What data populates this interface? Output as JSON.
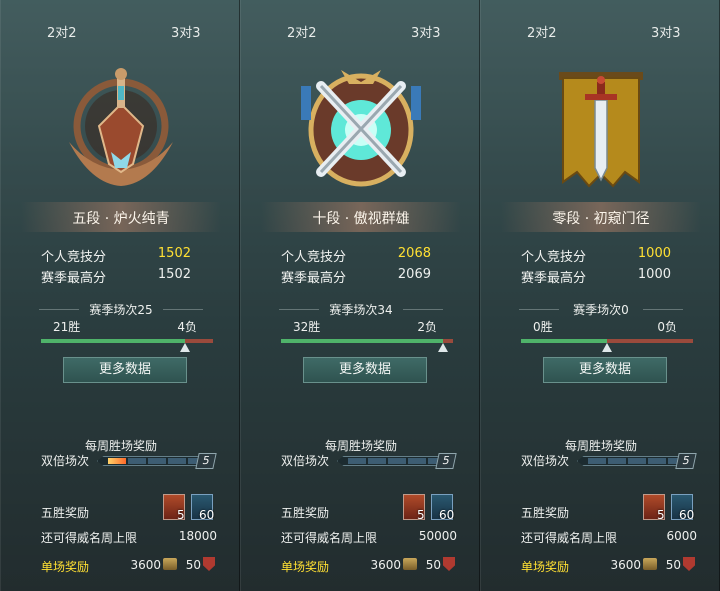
{
  "panels": [
    {
      "tabs": {
        "mode_2v2": "2对2",
        "mode_3v3": "3对3"
      },
      "emblem": "bronze-helmet-emblem",
      "rank_name": "五段 · 炉火纯青",
      "stats": {
        "personal_label": "个人竞技分",
        "personal_value": "1502",
        "season_high_label": "赛季最高分",
        "season_high_value": "1502"
      },
      "season_matches": "赛季场次25",
      "wins": "21胜",
      "losses": "4负",
      "win_fraction": 0.84,
      "more_data": "更多数据",
      "weekly": {
        "title": "每周胜场奖励",
        "double_label": "双倍场次",
        "double_count": "5",
        "double_lit": 1,
        "five_win_label": "五胜奖励",
        "reward_1_count": "5",
        "reward_2_count": "60",
        "cap_label": "还可得威名周上限",
        "cap_value": "18000",
        "single_label": "单场奖励",
        "single_coin": "3600",
        "single_badge": "50"
      }
    },
    {
      "tabs": {
        "mode_2v2": "2对2",
        "mode_3v3": "3对3"
      },
      "emblem": "crossed-swords-emblem",
      "rank_name": "十段 · 傲视群雄",
      "stats": {
        "personal_label": "个人竞技分",
        "personal_value": "2068",
        "season_high_label": "赛季最高分",
        "season_high_value": "2069"
      },
      "season_matches": "赛季场次34",
      "wins": "32胜",
      "losses": "2负",
      "win_fraction": 0.94,
      "more_data": "更多数据",
      "weekly": {
        "title": "每周胜场奖励",
        "double_label": "双倍场次",
        "double_count": "5",
        "double_lit": 0,
        "five_win_label": "五胜奖励",
        "reward_1_count": "5",
        "reward_2_count": "60",
        "cap_label": "还可得威名周上限",
        "cap_value": "50000",
        "single_label": "单场奖励",
        "single_coin": "3600",
        "single_badge": "50"
      }
    },
    {
      "tabs": {
        "mode_2v2": "2对2",
        "mode_3v3": "3对3"
      },
      "emblem": "sword-banner-emblem",
      "rank_name": "零段 · 初窥门径",
      "stats": {
        "personal_label": "个人竞技分",
        "personal_value": "1000",
        "season_high_label": "赛季最高分",
        "season_high_value": "1000"
      },
      "season_matches": "赛季场次0",
      "wins": "0胜",
      "losses": "0负",
      "win_fraction": 0.5,
      "more_data": "更多数据",
      "weekly": {
        "title": "每周胜场奖励",
        "double_label": "双倍场次",
        "double_count": "5",
        "double_lit": 0,
        "five_win_label": "五胜奖励",
        "reward_1_count": "5",
        "reward_2_count": "60",
        "cap_label": "还可得威名周上限",
        "cap_value": "6000",
        "single_label": "单场奖励",
        "single_coin": "3600",
        "single_badge": "50"
      }
    }
  ]
}
